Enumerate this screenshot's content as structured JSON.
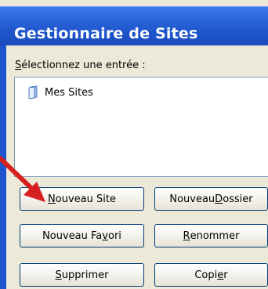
{
  "window": {
    "title": "Gestionnaire de Sites"
  },
  "prompt": {
    "mnemonic": "S",
    "rest": "électionnez une entrée :"
  },
  "tree": {
    "items": [
      {
        "label": "Mes Sites",
        "icon": "folder-icon"
      }
    ]
  },
  "buttons": {
    "nouveau_site": {
      "pre": "",
      "mnemonic": "N",
      "post": "ouveau Site"
    },
    "nouveau_dossier": {
      "pre": "Nouveau ",
      "mnemonic": "D",
      "post": "ossier"
    },
    "nouveau_favori": {
      "pre": "Nouveau Fa",
      "mnemonic": "v",
      "post": "ori"
    },
    "renommer": {
      "pre": "",
      "mnemonic": "R",
      "post": "enommer"
    },
    "supprimer": {
      "pre": "",
      "mnemonic": "S",
      "post": "upprimer"
    },
    "copier": {
      "pre": "Copi",
      "mnemonic": "e",
      "post": "r"
    }
  },
  "annotation": {
    "arrow_color": "#d62020",
    "icon": "red-arrow-icon"
  },
  "colors": {
    "titlebar": "#1f55cc",
    "window_bg": "#ece9d8",
    "button_border": "#003c74"
  }
}
